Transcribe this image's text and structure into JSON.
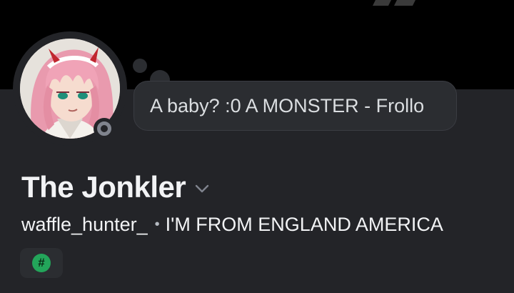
{
  "profile": {
    "display_name": "The Jonkler",
    "username": "waffle_hunter_",
    "separator": "•",
    "pronouns": "I'M FROM ENGLAND AMERICA",
    "custom_status": "A baby? :0 A MONSTER - Frollo",
    "status": "offline",
    "badge_symbol": "#",
    "badge_icon": "hashtag-badge-icon"
  },
  "colors": {
    "background": "#232428",
    "banner": "#000000",
    "bubble": "#2b2d31",
    "status_offline": "#80848e",
    "badge": "#23a55a"
  }
}
